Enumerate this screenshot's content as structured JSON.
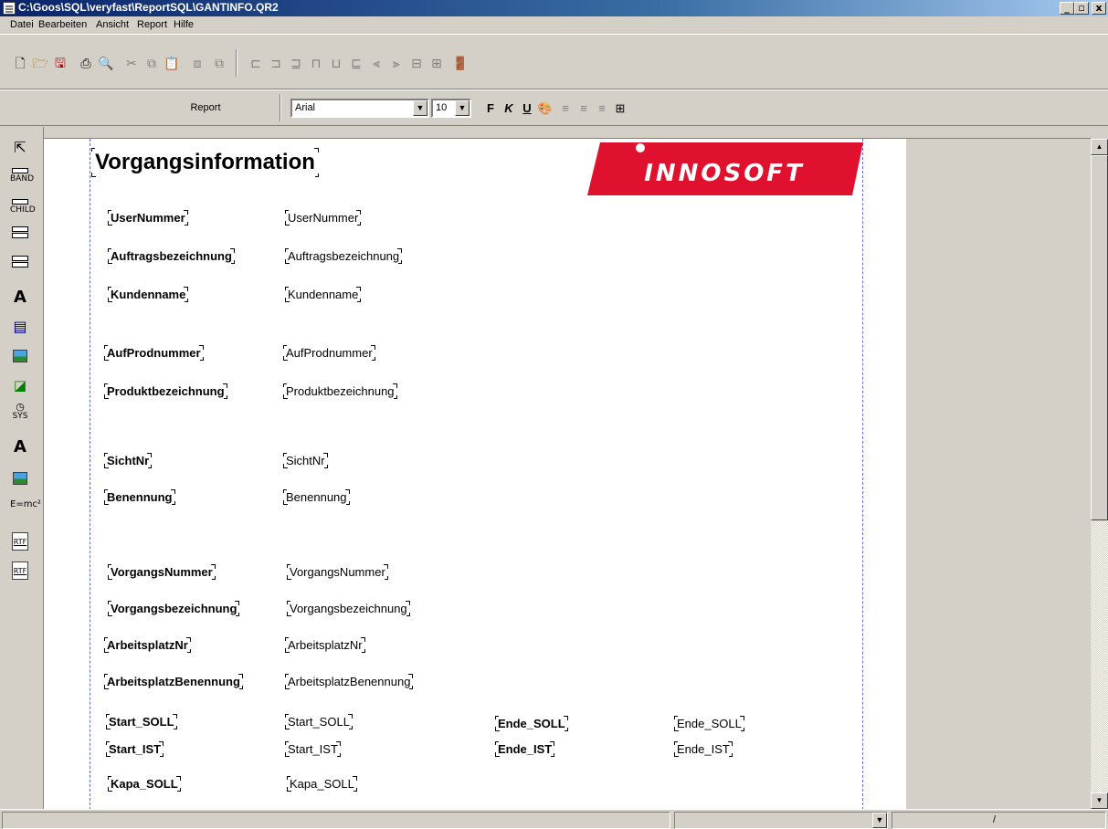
{
  "window": {
    "title": "C:\\Goos\\SQL\\veryfast\\ReportSQL\\GANTINFO.QR2",
    "buttons": {
      "minimize": "_",
      "maximize": "▫",
      "close": "x"
    }
  },
  "menu": [
    "Datei",
    "Bearbeiten",
    "Ansicht",
    "Report",
    "Hilfe"
  ],
  "toolbar2": {
    "report_label": "Report",
    "font_name": "Arial",
    "font_size": "10",
    "bold_label": "F",
    "italic_label": "K",
    "underline_label": "U"
  },
  "palette": [
    {
      "name": "pointer-tool",
      "label": ""
    },
    {
      "name": "band-tool",
      "label": "BAND"
    },
    {
      "name": "child-tool",
      "label": "CHILD"
    },
    {
      "name": "group-tool",
      "label": ""
    },
    {
      "name": "subdetail-tool",
      "label": ""
    },
    {
      "name": "label-tool",
      "label": "A"
    },
    {
      "name": "memo-tool",
      "label": ""
    },
    {
      "name": "image-tool",
      "label": ""
    },
    {
      "name": "shape-tool",
      "label": ""
    },
    {
      "name": "sysdata-tool",
      "label": "SYS"
    },
    {
      "name": "dbtext-tool",
      "label": "A"
    },
    {
      "name": "dbimage-tool",
      "label": ""
    },
    {
      "name": "expression-tool",
      "label": "E=mc²"
    },
    {
      "name": "richtext-tool",
      "label": "RTF"
    },
    {
      "name": "dbrichtext-tool",
      "label": "RTF"
    }
  ],
  "report": {
    "title": "Vorgangsinformation",
    "logo_text": "INNOSOFT",
    "labels": {
      "usernummer": "UserNummer",
      "auftragsbezeichnung": "Auftragsbezeichnung",
      "kundenname": "Kundenname",
      "aufprodnummer": "AufProdnummer",
      "produktbezeichnung": "Produktbezeichnung",
      "sichtnr": "SichtNr",
      "benennung": "Benennung",
      "vorgangsnummer": "VorgangsNummer",
      "vorgangsbezeichnung": "Vorgangsbezeichnung",
      "arbeitsplatznr": "ArbeitsplatzNr",
      "arbeitsplatzbenennung": "ArbeitsplatzBenennung",
      "start_soll": "Start_SOLL",
      "ende_soll": "Ende_SOLL",
      "start_ist": "Start_IST",
      "ende_ist": "Ende_IST",
      "kapa_soll": "Kapa_SOLL"
    },
    "fields": {
      "usernummer": "UserNummer",
      "auftragsbezeichnung": "Auftragsbezeichnung",
      "kundenname": "Kundenname",
      "aufprodnummer": "AufProdnummer",
      "produktbezeichnung": "Produktbezeichnung",
      "sichtnr": "SichtNr",
      "benennung": "Benennung",
      "vorgangsnummer": "VorgangsNummer",
      "vorgangsbezeichnung": "Vorgangsbezeichnung",
      "arbeitsplatznr": "ArbeitsplatzNr",
      "arbeitsplatzbenennung": "ArbeitsplatzBenennung",
      "start_soll": "Start_SOLL",
      "ende_soll": "Ende_SOLL",
      "start_ist": "Start_IST",
      "ende_ist": "Ende_IST",
      "kapa_soll": "Kapa_SOLL"
    }
  },
  "statusbar": {
    "right_text": "/"
  },
  "colors": {
    "titlebar": "#0a246a",
    "logo_red": "#e0102f",
    "margin_line": "#5b6fd6"
  }
}
